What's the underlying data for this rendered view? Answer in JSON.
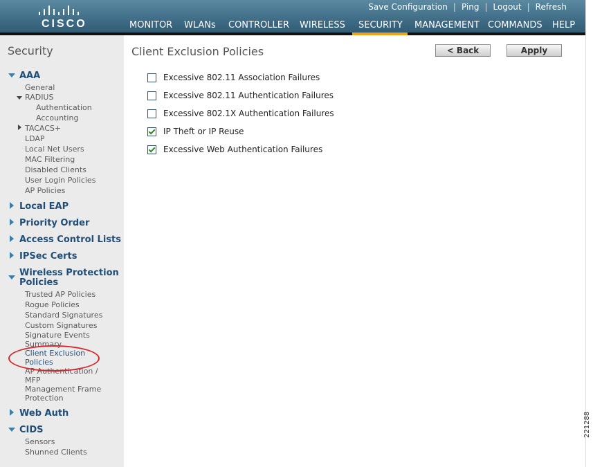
{
  "header": {
    "brand": "CISCO",
    "top_links": [
      "Save Configuration",
      "Ping",
      "Logout",
      "Refresh"
    ],
    "nav": [
      "MONITOR",
      "WLANs",
      "CONTROLLER",
      "WIRELESS",
      "SECURITY",
      "MANAGEMENT",
      "COMMANDS",
      "HELP"
    ],
    "active_nav": "SECURITY",
    "accent_color": "#f0a21b"
  },
  "sidebar": {
    "title": "Security",
    "aaa": {
      "label": "AAA",
      "general": "General",
      "radius": "RADIUS",
      "radius_items": [
        "Authentication",
        "Accounting"
      ],
      "tacacs": "TACACS+",
      "items": [
        "LDAP",
        "Local Net Users",
        "MAC Filtering",
        "Disabled Clients",
        "User Login Policies",
        "AP Policies"
      ]
    },
    "sections_collapsed": [
      "Local EAP",
      "Priority Order",
      "Access Control Lists",
      "IPSec Certs"
    ],
    "wireless_protection": {
      "label_line1": "Wireless Protection",
      "label_line2": "Policies",
      "items": [
        "Trusted AP Policies",
        "Rogue Policies",
        "Standard Signatures",
        "Custom Signatures",
        "Signature Events",
        "Summary"
      ],
      "active_line1": "Client Exclusion",
      "active_line2": "Policies",
      "after_items": [
        "AP Authentication /",
        "MFP",
        "Management Frame",
        "Protection"
      ]
    },
    "web_auth": "Web Auth",
    "cids": {
      "label": "CIDS",
      "items": [
        "Sensors",
        "Shunned Clients"
      ]
    }
  },
  "main": {
    "title": "Client Exclusion Policies",
    "back_label": "< Back",
    "apply_label": "Apply",
    "options": [
      {
        "label": "Excessive 802.11 Association Failures",
        "checked": false
      },
      {
        "label": "Excessive 802.11 Authentication Failures",
        "checked": false
      },
      {
        "label": "Excessive 802.1X Authentication Failures",
        "checked": false
      },
      {
        "label": "IP Theft or IP Reuse",
        "checked": true
      },
      {
        "label": "Excessive Web Authentication Failures",
        "checked": true
      }
    ]
  },
  "figure_number": "221288"
}
